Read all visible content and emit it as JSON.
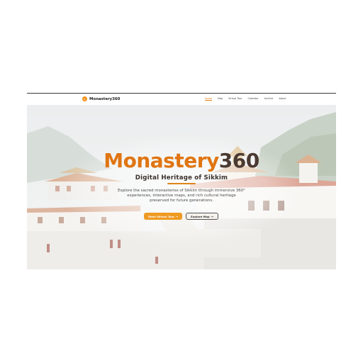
{
  "brand": {
    "name": "Monastery360",
    "icon": "monastery-logo-icon"
  },
  "nav": [
    {
      "label": "Home",
      "active": true
    },
    {
      "label": "Map",
      "active": false
    },
    {
      "label": "Virtual Tour",
      "active": false
    },
    {
      "label": "Calendar",
      "active": false
    },
    {
      "label": "Archive",
      "active": false
    },
    {
      "label": "About",
      "active": false
    }
  ],
  "hero": {
    "title_part1": "Monastery",
    "title_part2": "360",
    "subtitle": "Digital Heritage of Sikkim",
    "description": "Explore the sacred monasteries of Sikkim through immersive 360° experiences, interactive maps, and rich cultural heritage preserved for future generations.",
    "primary_button": "Start Virtual Tour",
    "primary_icon": "arrow-right-icon",
    "secondary_button": "Explore Map",
    "secondary_icon": "arrow-right-icon"
  },
  "colors": {
    "accent": "#e07512",
    "button": "#ef9a22",
    "dark": "#4a3a32"
  }
}
